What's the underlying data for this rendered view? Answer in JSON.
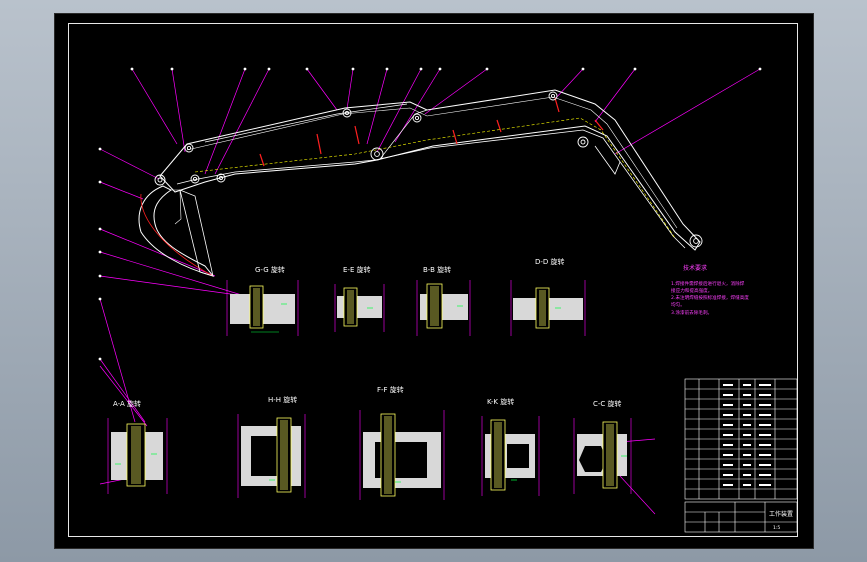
{
  "drawing": {
    "section_labels": {
      "g": "G-G 旋转",
      "e": "E-E 旋转",
      "b": "B-B 旋转",
      "d": "D-D 旋转",
      "a": "A-A 旋转",
      "h": "H-H 旋转",
      "f": "F-F 旋转",
      "k": "K-K 旋转",
      "c": "C-C 旋转"
    },
    "notes": {
      "title": "技术要求",
      "lines": [
        "1.焊接件需焊接后进行退火，消除焊",
        "接应力和提高强度。",
        "2.未注明焊缝按照标准焊接，焊缝高度",
        "均匀。",
        "3.涂漆前去除毛刺。"
      ]
    },
    "title_block": {
      "drawing_name": "工作装置",
      "scale": "1:5"
    },
    "colors": {
      "line": "#ffffff",
      "leader": "#ff00ff",
      "section": "#ff2020",
      "dimension": "#00ff40",
      "pin": "#ffff60",
      "hidden": "#ffff00"
    }
  }
}
